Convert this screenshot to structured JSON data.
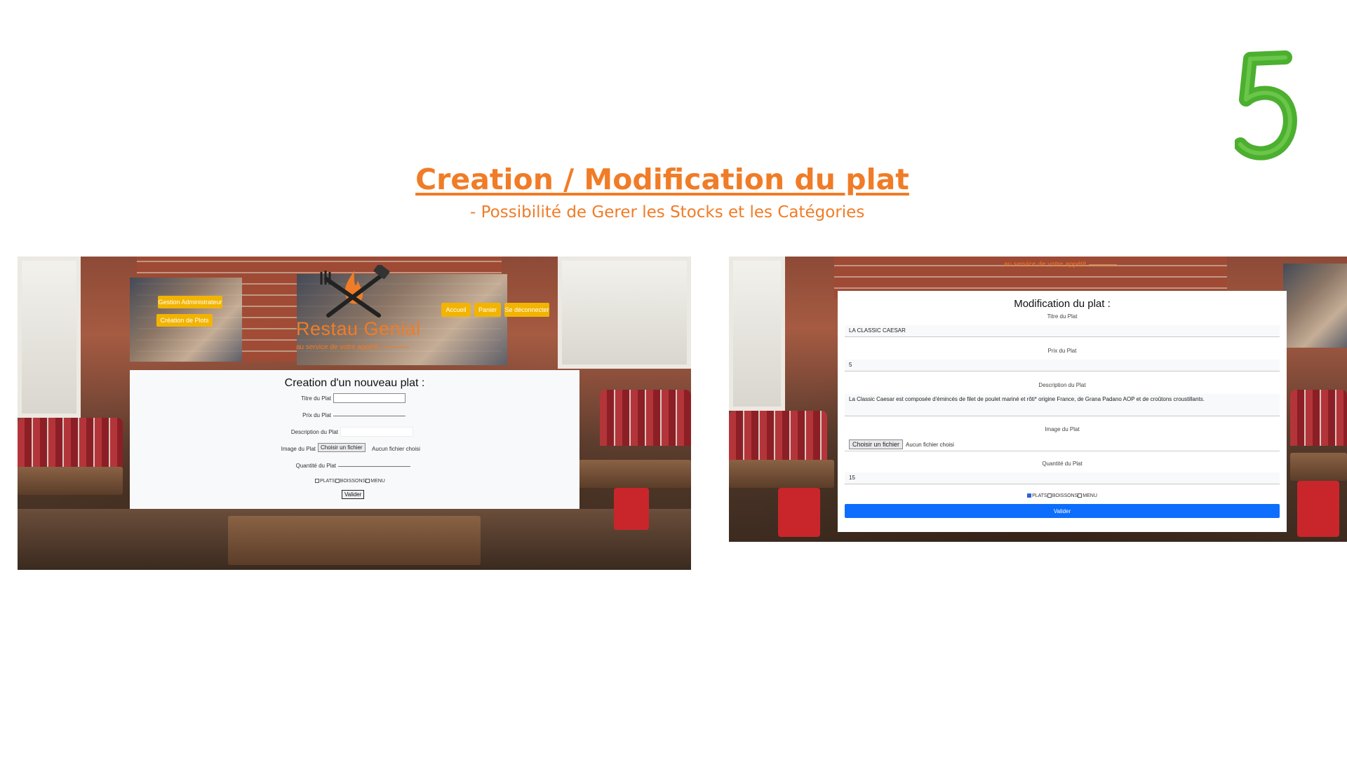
{
  "slide": {
    "number": "5",
    "title": "Creation / Modification du plat",
    "subtitle": "- Possibilité de Gerer les Stocks et les Catégories"
  },
  "left_screen": {
    "admin_buttons": [
      "Gestion Administrateur",
      "Création de Plots"
    ],
    "nav_buttons": [
      "Accueil",
      "Panier",
      "Se déconnecter"
    ],
    "brand": "Restau Genial",
    "tagline": "au service de votre appétit",
    "form": {
      "title": "Creation d'un nouveau plat :",
      "fields": {
        "titre": "Titre du Plat",
        "prix": "Prix du Plat",
        "description": "Description du Plat",
        "image": "Image du Plat",
        "quantite": "Quantité du Plat"
      },
      "file_button": "Choisir un fichier",
      "file_status": "Aucun fichier choisi",
      "categories": [
        "PLATS",
        "BOISSONS",
        "MENU"
      ],
      "submit": "Valider"
    }
  },
  "right_screen": {
    "tagline": "au service de votre appétit",
    "form": {
      "title": "Modification du plat :",
      "labels": {
        "titre": "Titre du Plat",
        "prix": "Prix du Plat",
        "description": "Description du Plat",
        "image": "Image du Plat",
        "quantite": "Quantité du Plat"
      },
      "values": {
        "titre": "LA CLASSIC CAESAR",
        "prix": "5",
        "description": "La Classic Caesar est composée d'émincés de filet de poulet mariné et rôti* origine France, de Grana Padano AOP et de croûtons croustillants.",
        "quantite": "15"
      },
      "file_button": "Choisir un fichier",
      "file_status": "Aucun fichier choisi",
      "categories": [
        "PLATS",
        "BOISSONS",
        "MENU"
      ],
      "checked": [
        "PLATS"
      ],
      "submit": "Valider"
    }
  },
  "colors": {
    "accent": "#f07c27",
    "nav_yellow": "#f2b400",
    "primary_blue": "#0d6efd",
    "slide_number_green": "#4caf2f"
  }
}
